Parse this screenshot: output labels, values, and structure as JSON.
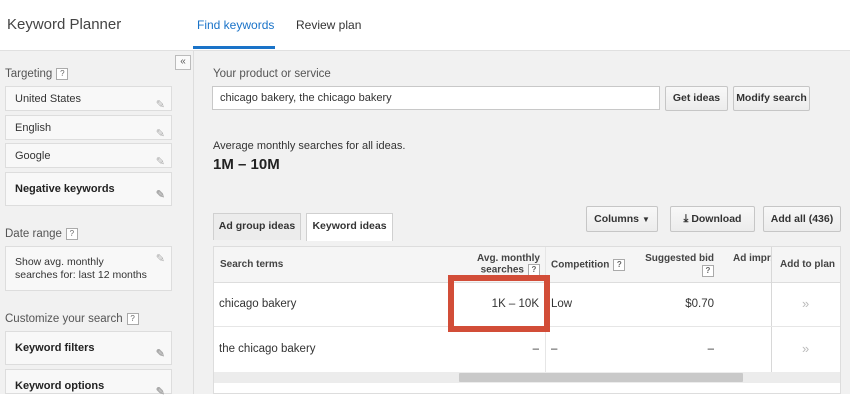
{
  "app": {
    "title": "Keyword Planner"
  },
  "tabs": [
    {
      "label": "Find keywords",
      "active": true
    },
    {
      "label": "Review plan",
      "active": false
    }
  ],
  "sidebar": {
    "collapse_icon": "«",
    "targeting_label": "Targeting",
    "targeting_items": [
      "United States",
      "English",
      "Google",
      "Negative keywords"
    ],
    "date_range_label": "Date range",
    "date_range_value": "Show avg. monthly searches for: last 12 months",
    "customize_label": "Customize your search",
    "customize_items": [
      "Keyword filters",
      "Keyword options"
    ]
  },
  "search": {
    "label": "Your product or service",
    "value": "chicago bakery, the chicago bakery",
    "get_ideas": "Get ideas",
    "modify_search": "Modify search"
  },
  "summary": {
    "label": "Average monthly searches for all ideas.",
    "value": "1M – 10M"
  },
  "idea_tabs": [
    "Ad group ideas",
    "Keyword ideas"
  ],
  "toolbar": {
    "columns": "Columns",
    "download": "Download",
    "add_all": "Add all (436)"
  },
  "table": {
    "headers": {
      "search_terms": "Search terms",
      "avg_monthly_1": "Avg. monthly",
      "avg_monthly_2": "searches",
      "competition": "Competition",
      "suggested_bid": "Suggested bid",
      "ad_impr": "Ad impr.",
      "add_to_plan": "Add to plan"
    },
    "rows": [
      {
        "term": "chicago bakery",
        "searches": "1K – 10K",
        "competition": "Low",
        "bid": "$0.70",
        "add": "»"
      },
      {
        "term": "the chicago bakery",
        "searches": "–",
        "competition": "–",
        "bid": "–",
        "add": "»"
      }
    ]
  },
  "colors": {
    "accent": "#1a73c8",
    "highlight": "#d24d38"
  }
}
